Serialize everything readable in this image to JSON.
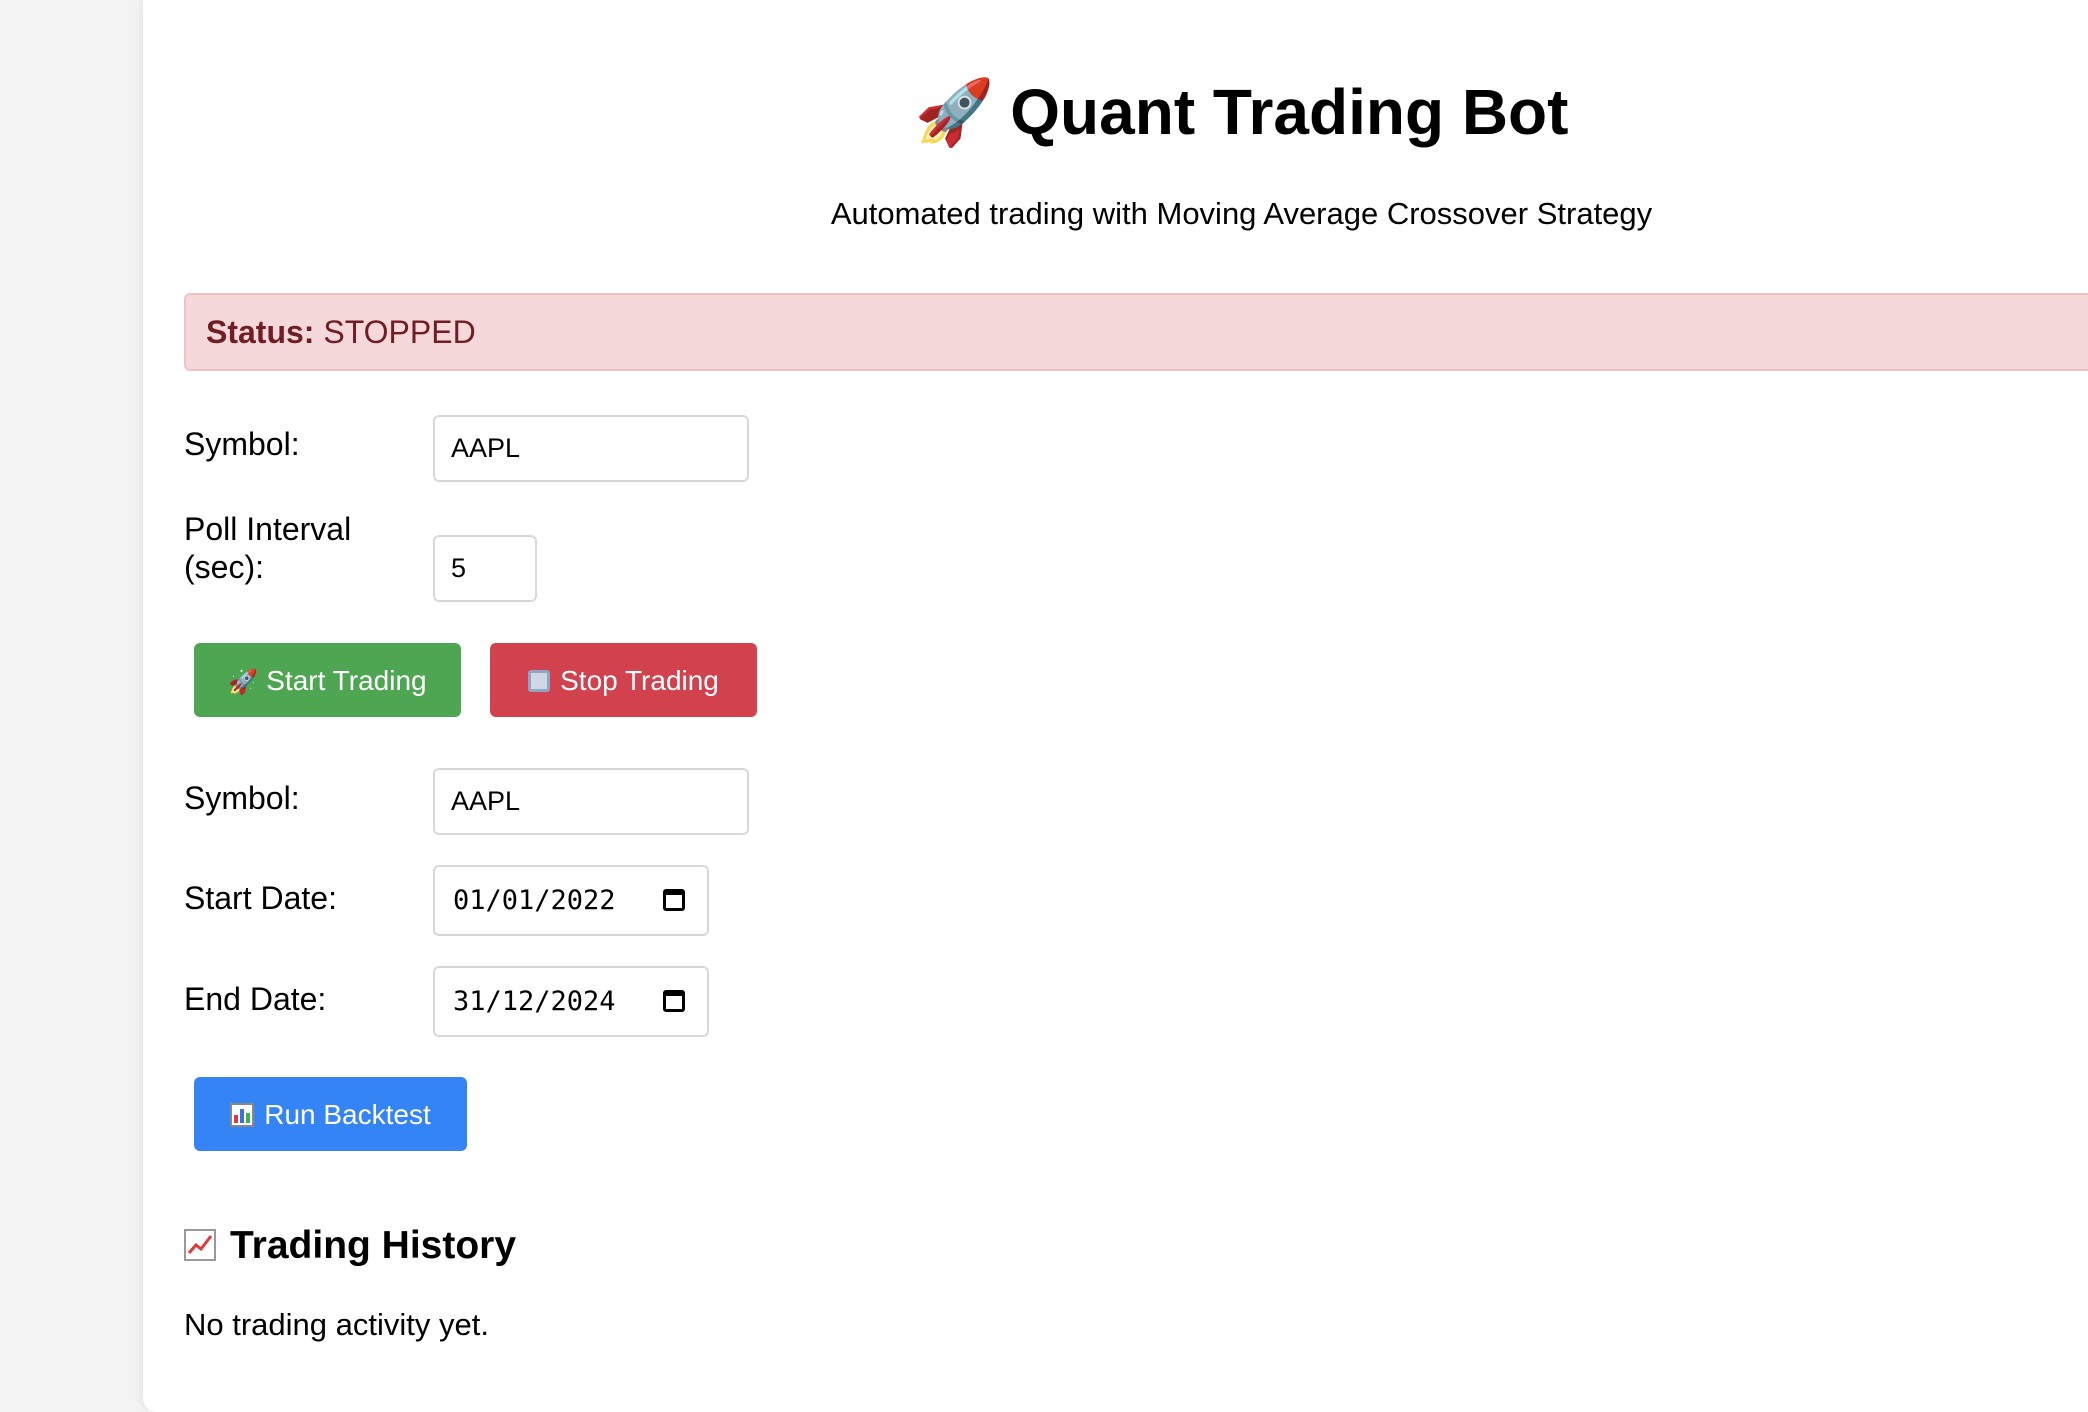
{
  "header": {
    "title_icon": "rocket-icon",
    "title": "Quant Trading Bot",
    "subtitle": "Automated trading with Moving Average Crossover Strategy"
  },
  "status": {
    "label": "Status:",
    "value": "STOPPED",
    "color": "#721c24",
    "background": "#f4d8da"
  },
  "live": {
    "symbol_label": "Symbol:",
    "symbol_value": "AAPL",
    "poll_label_line1": "Poll Interval",
    "poll_label_line2": "(sec):",
    "poll_value": "5",
    "start_button": "Start Trading",
    "stop_button": "Stop Trading"
  },
  "backtest": {
    "symbol_label": "Symbol:",
    "symbol_value": "AAPL",
    "start_label": "Start Date:",
    "start_value": "01/01/2022",
    "end_label": "End Date:",
    "end_value": "31/12/2024",
    "run_button": "Run Backtest"
  },
  "history": {
    "title": "Trading History",
    "empty_text": "No trading activity yet."
  },
  "colors": {
    "start": "#4ea653",
    "stop": "#d1414e",
    "backtest": "#3484f5"
  }
}
